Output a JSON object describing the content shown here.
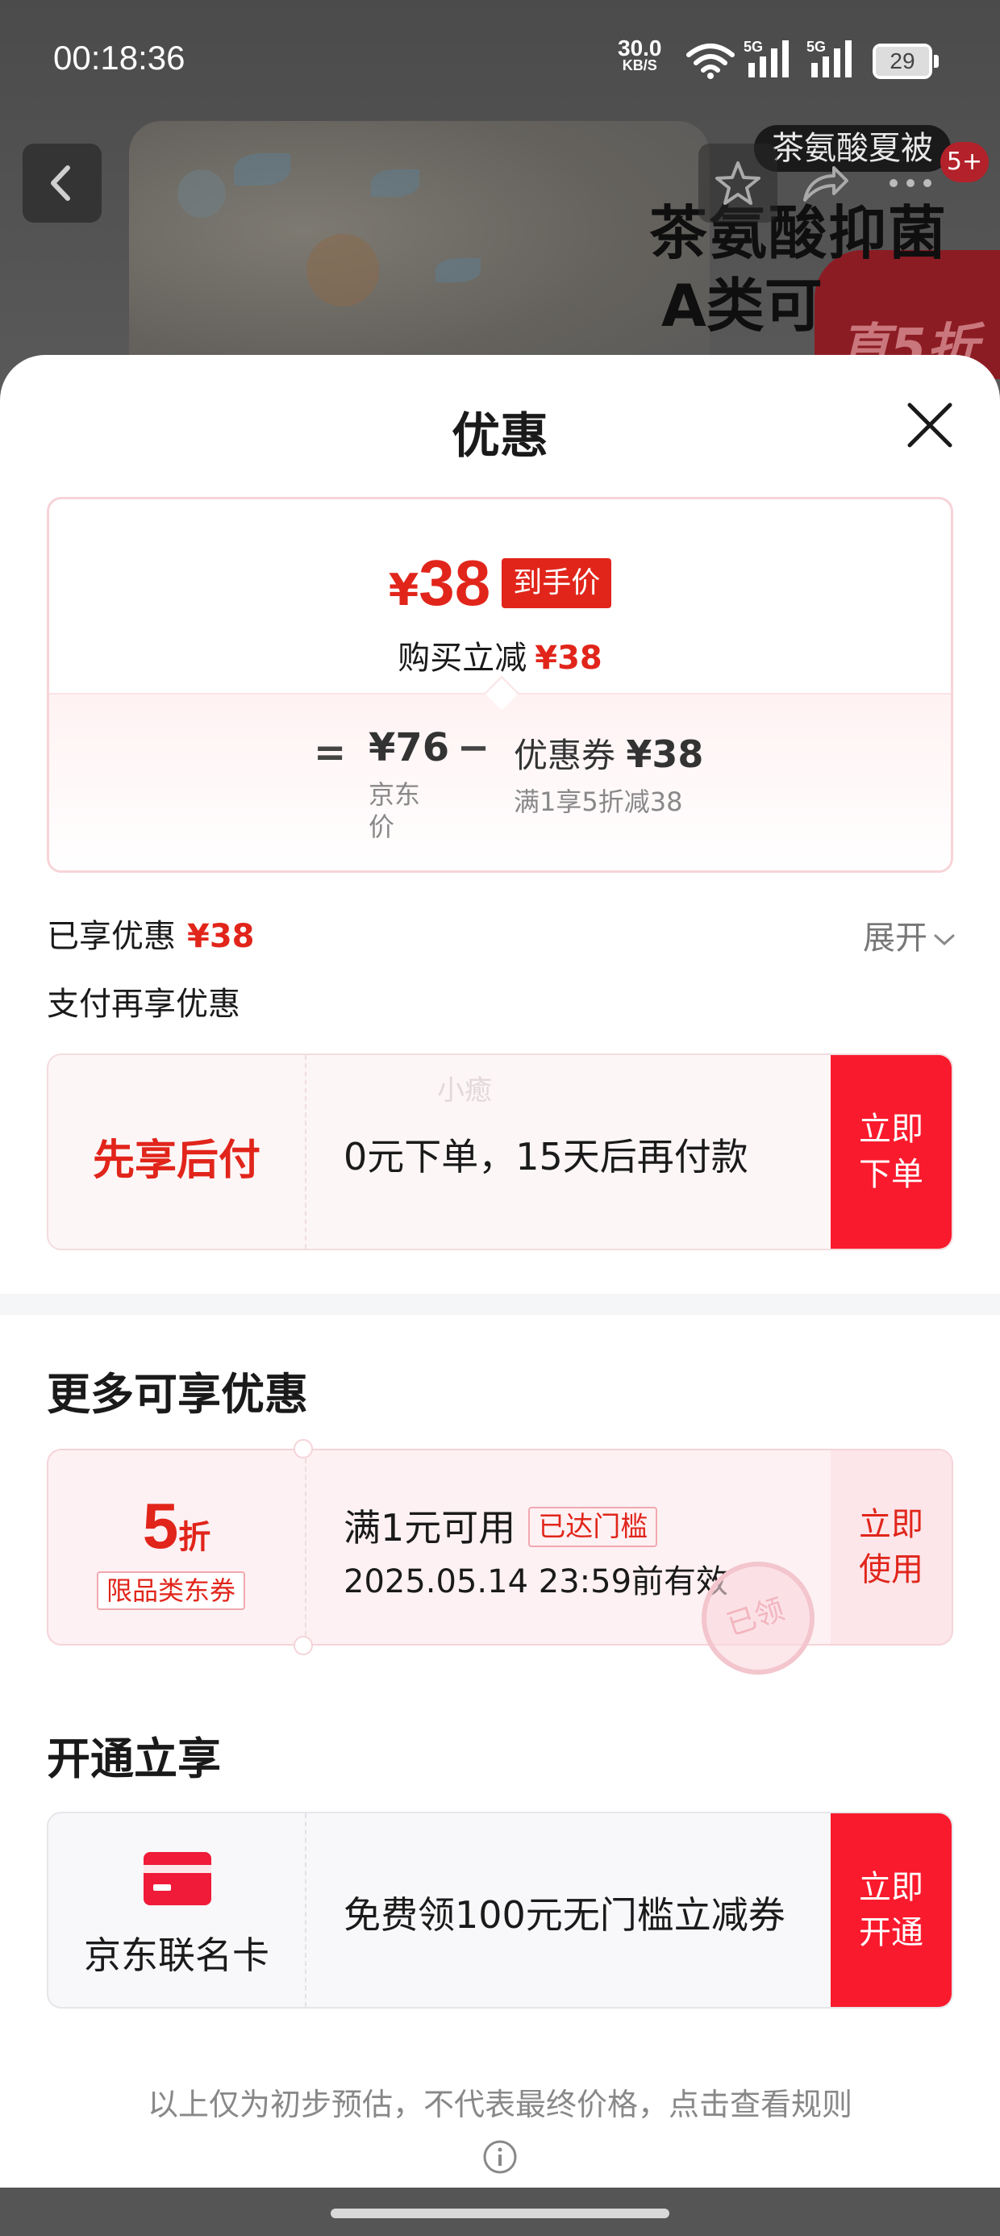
{
  "status_bar": {
    "time": "00:18:36",
    "net_speed": "30.0",
    "net_unit": "KB/S",
    "sim1": "5G",
    "sim2": "5G",
    "battery": "29"
  },
  "background_page": {
    "product_tag": "茶氨酸夏被",
    "tag_count": "5+",
    "headline_line1": "茶氨酸抑菌",
    "headline_line2": "A类可",
    "promo_badge": "直5折"
  },
  "sheet": {
    "title": "优惠",
    "price_card": {
      "currency": "¥",
      "final_price": "38",
      "final_tag": "到手价",
      "discount_text": "购买立减",
      "discount_amount": "¥38",
      "equals": "=",
      "original_price": "¥76",
      "original_label": "京东价",
      "minus": "−",
      "coupon_label": "优惠券",
      "coupon_amount": "¥38",
      "coupon_rule": "满1享5折减38"
    },
    "enjoyed_label": "已享优惠",
    "enjoyed_amount": "¥38",
    "expand_label": "展开",
    "pay_more_label": "支付再享优惠",
    "bnpl": {
      "title": "先享后付",
      "desc": "0元下单，15天后再付款",
      "button": "立即下单",
      "watermark": "小癒"
    },
    "more_title": "更多可享优惠",
    "coupon": {
      "amount": "5",
      "unit": "折",
      "category_label": "限品类东券",
      "condition": "满1元可用",
      "status_badge": "已达门槛",
      "expiry": "2025.05.14 23:59前有效",
      "button": "立即使用",
      "stamp": "已领"
    },
    "open_title": "开通立享",
    "jd_card": {
      "name": "京东联名卡",
      "desc": "免费领100元无门槛立减券",
      "button": "立即开通"
    },
    "footer_note": "以上仅为初步预估，不代表最终价格，点击查看规则"
  },
  "colors": {
    "accent_red": "#e1251b",
    "button_red": "#fa1a2d",
    "backdrop": "#5b5b5b"
  },
  "icons": [
    "back-arrow-icon",
    "star-icon",
    "share-icon",
    "more-icon",
    "close-icon",
    "chevron-down-icon",
    "credit-card-icon",
    "info-icon",
    "wifi-icon",
    "signal-icon",
    "battery-icon"
  ]
}
